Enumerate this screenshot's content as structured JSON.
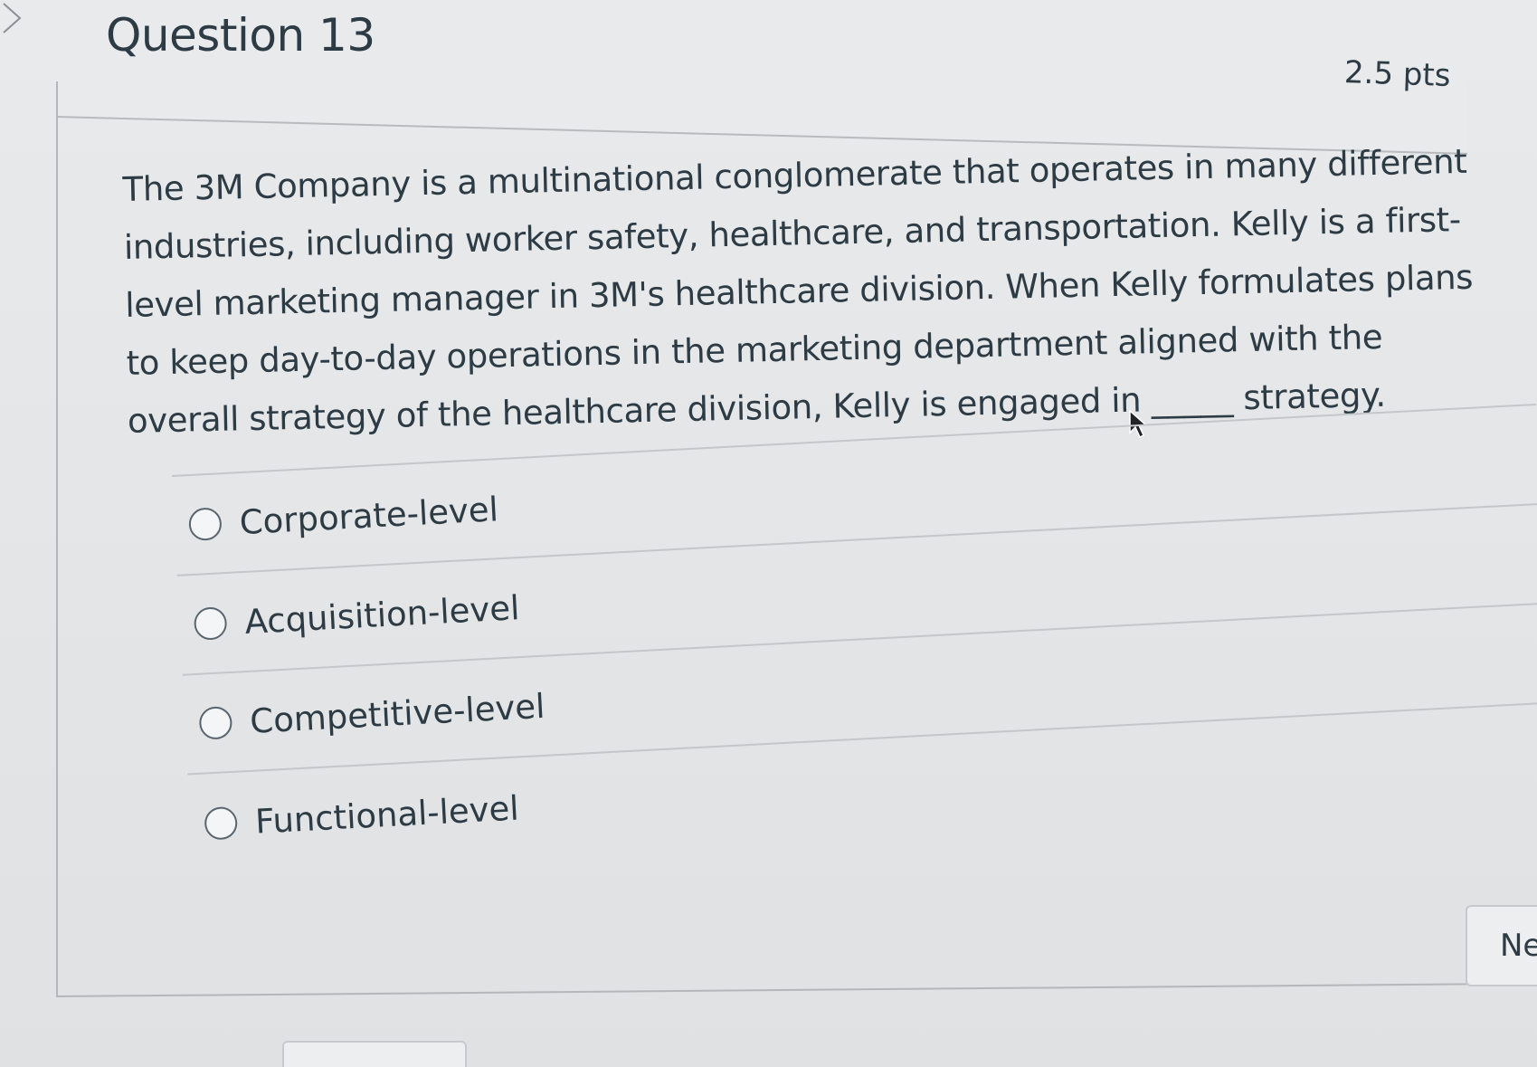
{
  "question": {
    "title": "Question 13",
    "points": "2.5 pts",
    "text": "The 3M Company is a multinational conglomerate that operates in many different industries, including worker safety, healthcare, and transportation. Kelly is a first-level marketing manager in 3M's healthcare division. When Kelly formulates plans to keep day-to-day operations in the marketing department aligned with the overall strategy of the healthcare division, Kelly is engaged in _____ strategy."
  },
  "answers": [
    {
      "label": "Corporate-level",
      "selected": false
    },
    {
      "label": "Acquisition-level",
      "selected": false
    },
    {
      "label": "Competitive-level",
      "selected": false
    },
    {
      "label": "Functional-level",
      "selected": false
    }
  ],
  "navigation": {
    "next_label": "Ne"
  },
  "icons": {
    "collapse": "chevron-right-icon",
    "cursor": "mouse-pointer-icon"
  }
}
